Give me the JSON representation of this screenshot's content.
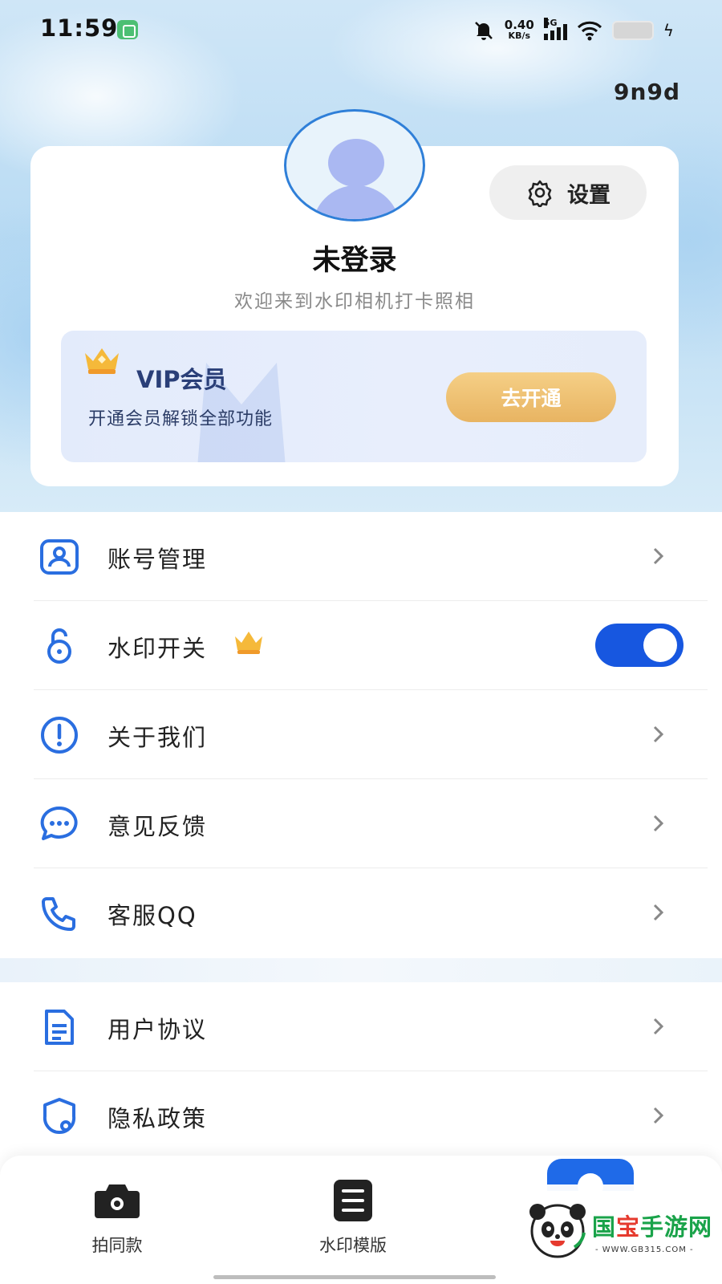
{
  "status_bar": {
    "time": "11:59",
    "net_speed_value": "0.40",
    "net_speed_unit": "KB/s",
    "network_type": "5G"
  },
  "header": {
    "tag": "9n9d"
  },
  "profile": {
    "settings_label": "设置",
    "login_status": "未登录",
    "welcome": "欢迎来到水印相机打卡照相"
  },
  "vip": {
    "title": "VIP会员",
    "subtitle": "开通会员解锁全部功能",
    "button_label": "去开通"
  },
  "menu": {
    "items": [
      {
        "label": "账号管理",
        "icon": "account-icon"
      },
      {
        "label": "水印开关",
        "icon": "lock-icon",
        "toggle_on": true
      },
      {
        "label": "关于我们",
        "icon": "info-icon"
      },
      {
        "label": "意见反馈",
        "icon": "chat-icon"
      },
      {
        "label": "客服QQ",
        "icon": "phone-icon"
      }
    ],
    "items2": [
      {
        "label": "用户协议",
        "icon": "document-icon"
      },
      {
        "label": "隐私政策",
        "icon": "shield-icon"
      }
    ]
  },
  "bottom_nav": {
    "items": [
      {
        "label": "拍同款",
        "icon": "camera-icon"
      },
      {
        "label": "水印模版",
        "icon": "template-icon"
      }
    ]
  },
  "watermark": {
    "brand_prefix": "国",
    "brand_red": "宝",
    "brand_suffix": "手游网",
    "url": "- WWW.GB315.COM -"
  },
  "colors": {
    "accent": "#1757e0",
    "vip_button": "#e8b462",
    "icon_blue": "#2a6ee0"
  }
}
